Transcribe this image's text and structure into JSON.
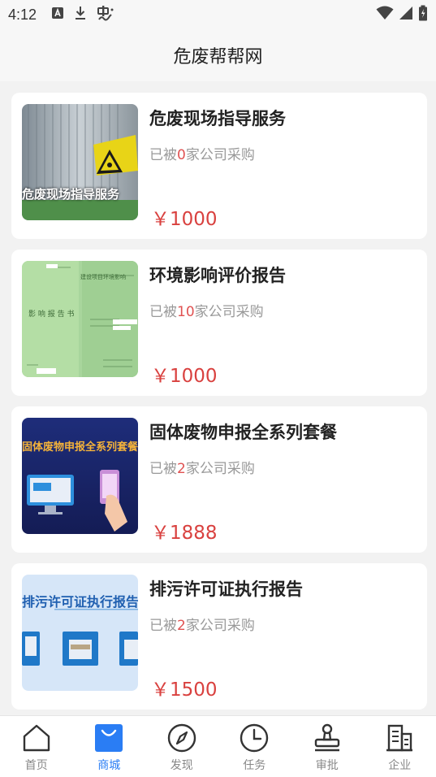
{
  "status_bar": {
    "time": "4:12"
  },
  "header": {
    "title": "危废帮帮网"
  },
  "products": [
    {
      "title": "危废现场指导服务",
      "sales_prefix": "已被",
      "sales_count": "0",
      "sales_suffix": "家公司采购",
      "price": "￥1000",
      "thumb_caption": "危废现场指导服务"
    },
    {
      "title": "环境影响评价报告",
      "sales_prefix": "已被",
      "sales_count": "10",
      "sales_suffix": "家公司采购",
      "price": "￥1000",
      "thumb_caption": "影 响 报 告 书"
    },
    {
      "title": "固体废物申报全系列套餐",
      "sales_prefix": "已被",
      "sales_count": "2",
      "sales_suffix": "家公司采购",
      "price": "￥1888",
      "thumb_caption": "固体废物申报全系列套餐"
    },
    {
      "title": "排污许可证执行报告",
      "sales_prefix": "已被",
      "sales_count": "2",
      "sales_suffix": "家公司采购",
      "price": "￥1500",
      "thumb_caption": "排污许可证执行报告"
    }
  ],
  "tabs": [
    {
      "label": "首页",
      "icon": "home-icon"
    },
    {
      "label": "商城",
      "icon": "shop-bag-icon",
      "active": true
    },
    {
      "label": "发现",
      "icon": "compass-icon"
    },
    {
      "label": "任务",
      "icon": "clock-icon"
    },
    {
      "label": "审批",
      "icon": "stamp-icon"
    },
    {
      "label": "企业",
      "icon": "building-icon"
    }
  ],
  "colors": {
    "accent": "#2a7df4",
    "price": "#d9413f",
    "sales_count": "#e05252",
    "background": "#f2f2f2"
  }
}
